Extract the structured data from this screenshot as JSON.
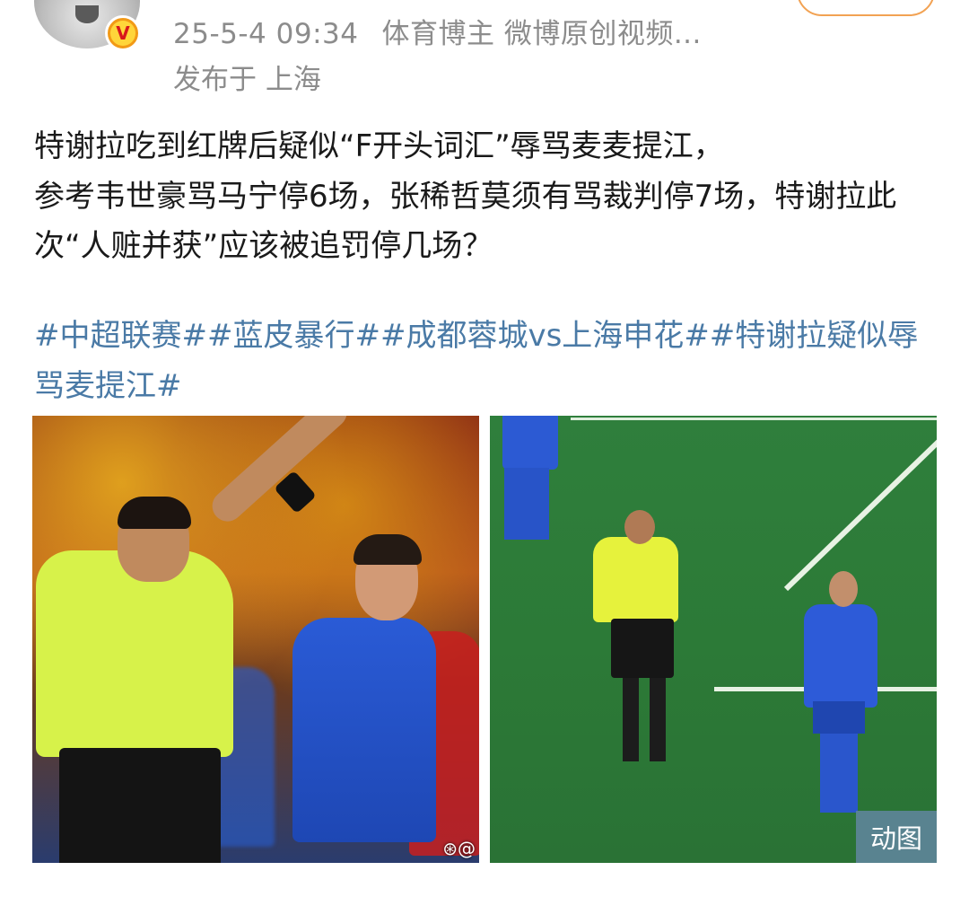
{
  "post": {
    "meta": {
      "timestamp": "25-5-4 09:34",
      "author_tag": "体育博主 微博原创视频...",
      "location": "发布于 上海"
    },
    "text_lines": [
      "特谢拉吃到红牌后疑似“F开头词汇”辱骂麦麦提江，",
      "参考韦世豪骂马宁停6场，张稀哲莫须有骂裁判停7场，特谢拉此次“人赃并获”应该被追罚停几场？"
    ],
    "hashtags": [
      "#中超联赛#",
      "#蓝皮暴行#",
      "#成都蓉城vs上海申花#",
      "#特谢拉疑似辱骂麦提江#"
    ],
    "images": {
      "left_watermark": "⊛@",
      "right_badge": "动图"
    }
  },
  "colors": {
    "hashtag": "#4a7aa6",
    "meta_text": "#8c8c8c",
    "verified_badge": "#f29a16",
    "follow_border": "#f2a253"
  },
  "icons": {
    "verified": "verified-v-icon",
    "weibo_watermark": "weibo-logo-icon"
  }
}
